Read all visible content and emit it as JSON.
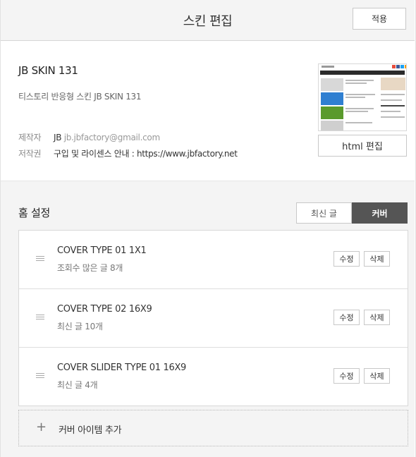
{
  "header": {
    "title": "스킨 편집",
    "apply_label": "적용"
  },
  "skin": {
    "name": "JB SKIN 131",
    "description": "티스토리 반응형 스킨 JB SKIN 131",
    "author_key": "제작자",
    "author_name": "JB",
    "author_email": "jb.jbfactory@gmail.com",
    "license_key": "저작권",
    "license_text": "구입 및 라이센스 안내 : https://www.jbfactory.net",
    "html_edit_label": "html 편집"
  },
  "home": {
    "title": "홈 설정",
    "toggle": {
      "recent_label": "최신 글",
      "cover_label": "커버",
      "active": "cover"
    },
    "items": [
      {
        "title": "COVER TYPE 01 1X1",
        "sub": "조회수 많은 글 8개",
        "edit": "수정",
        "delete": "삭제"
      },
      {
        "title": "COVER TYPE 02 16X9",
        "sub": "최신 글 10개",
        "edit": "수정",
        "delete": "삭제"
      },
      {
        "title": "COVER SLIDER TYPE 01 16X9",
        "sub": "최신 글 4개",
        "edit": "수정",
        "delete": "삭제"
      }
    ],
    "add_plus": "+",
    "add_label": "커버 아이템 추가"
  }
}
